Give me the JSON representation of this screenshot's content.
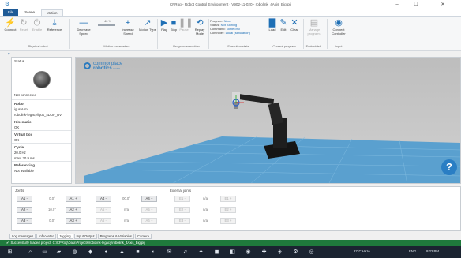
{
  "window": {
    "title": "CPRog - Robot Control Environment - V902-11-020 - robolink_4Axis_Big.prj",
    "minimize": "–",
    "maximize": "☐",
    "close": "✕"
  },
  "tabs": [
    "File",
    "Scene",
    "Motion"
  ],
  "ribbon": {
    "physical": {
      "connect": "Connect",
      "reset": "Reset",
      "enable": "Enable",
      "reference": "Reference",
      "group": "Physical robot"
    },
    "motion": {
      "decrease": "Decrease Speed",
      "speed_pct": "40 %",
      "increase": "Increase Speed",
      "motion_type": "Motion Type",
      "group": "Motion parameters"
    },
    "program": {
      "play": "Play",
      "stop": "Stop",
      "pause": "Pause",
      "replay": "Replay Mode",
      "group": "Program execution"
    },
    "exec_state": {
      "program_label": "Program:",
      "program_value": "None",
      "status_label": "Status:",
      "status_value": "Not running",
      "command_label": "Command:",
      "command_value": "None of 0",
      "controller_label": "Controller:",
      "controller_value": "Local (simulation)",
      "group": "Execution state"
    },
    "current": {
      "load": "Load",
      "edit": "Edit",
      "clear": "Clear",
      "group": "Current program"
    },
    "embedded": {
      "manage": "Manage programs",
      "group": "Embedded..."
    },
    "input": {
      "connect_controller": "Connect Controller",
      "group": "Input"
    }
  },
  "left_panel": {
    "status_title": "Status",
    "status_value": "Not connected",
    "robot_head": "Robot",
    "robot_lines": [
      "igus Arm",
      "robolink-legacy/igus_4DOF_BV"
    ],
    "kinematic_head": "Kinematic",
    "kinematic_value": "OK",
    "virtual_head": "Virtual box",
    "virtual_value": "OK",
    "cycle_head": "Cycle",
    "cycle_lines": [
      "20.0 Hz",
      "max. 30.9 ms"
    ],
    "ref_head": "Referencing",
    "ref_value": "Not available"
  },
  "viewport": {
    "logo_line1": "commonplace",
    "logo_line2": "robotics",
    "logo_suffix": "GmbH",
    "help": "?"
  },
  "joints": {
    "joints_label": "Joints",
    "external_label": "External joints",
    "rows": [
      {
        "minus": "A1 -",
        "value": "0.0°",
        "plus": "A1 +"
      },
      {
        "minus": "A2 -",
        "value": "10.0°",
        "plus": "A2 +"
      },
      {
        "minus": "A3 -",
        "value": "0.0°",
        "plus": "A3 +"
      }
    ],
    "a4": {
      "minus": "A4 -",
      "value": "00.0°",
      "plus": "A4 +"
    },
    "a5": {
      "minus": "A5 -",
      "value": "n/a",
      "plus": "A5 +"
    },
    "a6": {
      "minus": "A6 -",
      "value": "n/a",
      "plus": "A6 +"
    },
    "external": [
      {
        "minus": "E1 -",
        "value": "n/a",
        "plus": "E1 +"
      },
      {
        "minus": "E2 -",
        "value": "n/a",
        "plus": "E2 +"
      },
      {
        "minus": "E3 -",
        "value": "n/a",
        "plus": "E3 +"
      }
    ]
  },
  "bottom_tabs": [
    "Log messages",
    "Infocenter",
    "Jogging",
    "Input/Output",
    "Programs & Variables",
    "Camera"
  ],
  "status_message": "Successfully loaded project: C:\\CPRog\\Data\\Projects\\robolink-legacy\\robolink_4Axis_Big.prj",
  "taskbar": {
    "weather": "27°C Haze",
    "lang": "ENG",
    "time": "9:22 PM"
  }
}
